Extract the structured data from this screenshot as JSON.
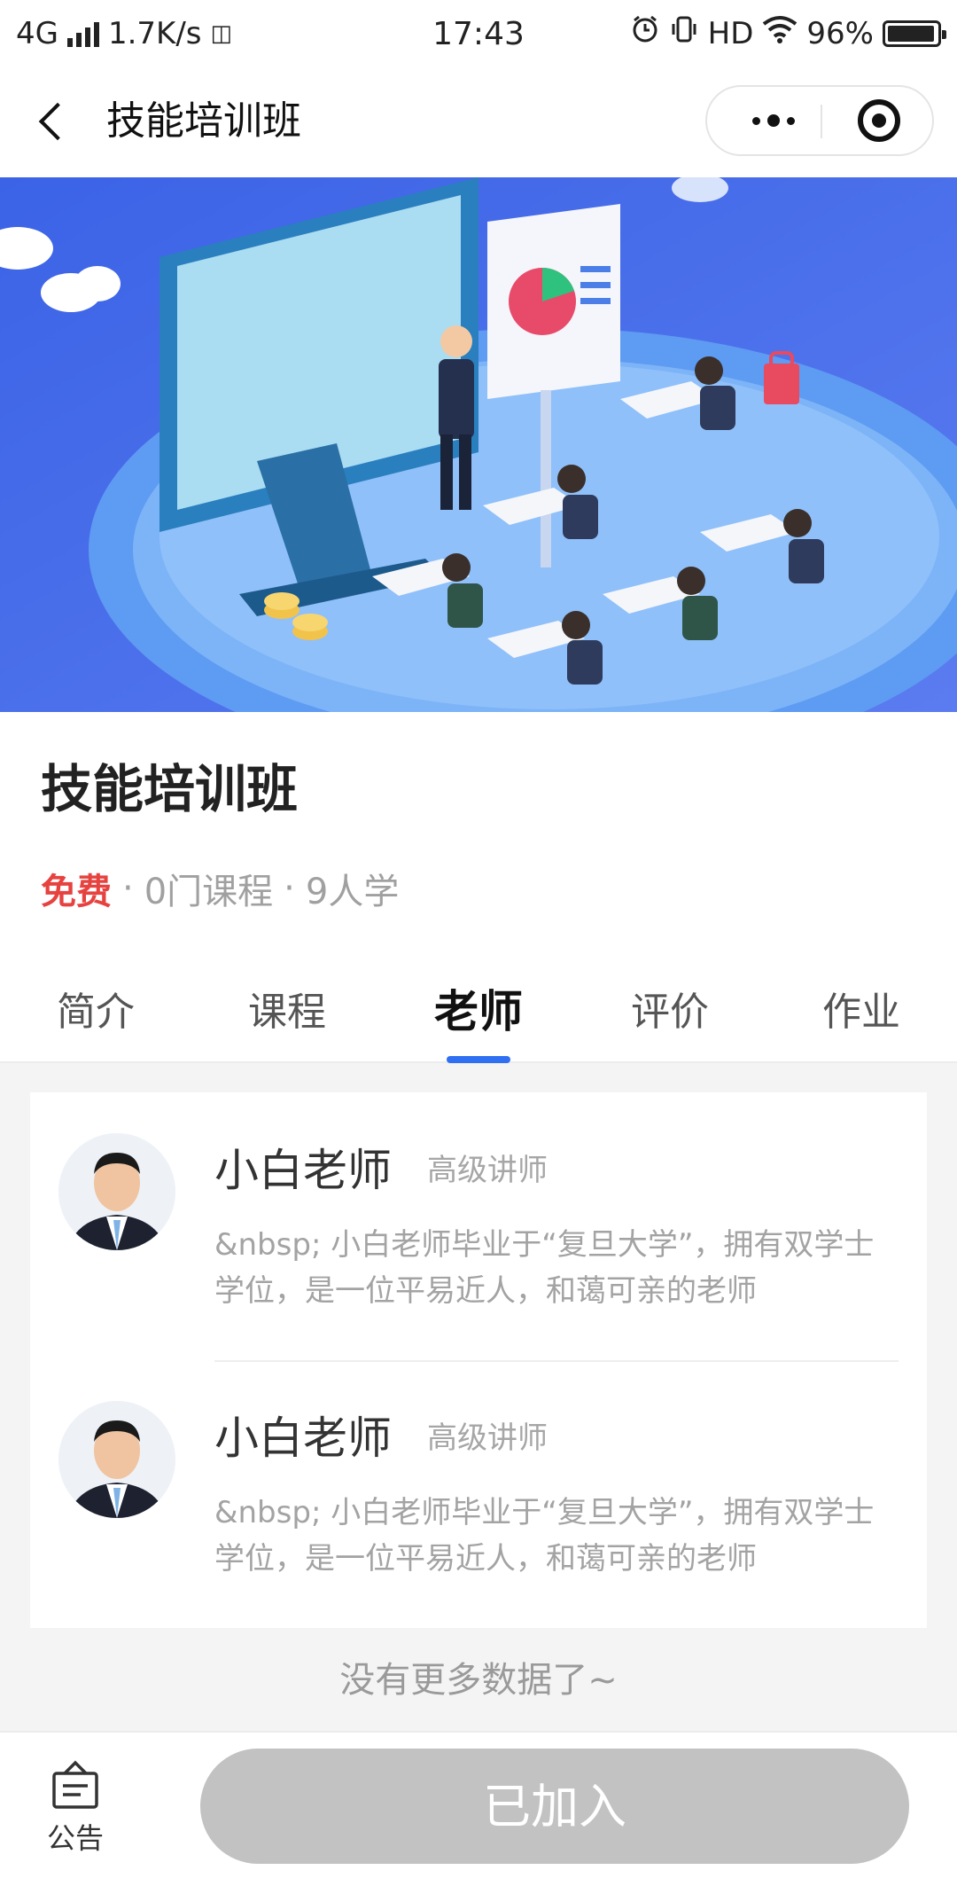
{
  "status_bar": {
    "network": "4G",
    "speed": "1.7K/s",
    "time": "17:43",
    "hd": "HD",
    "battery": "96%",
    "battery_level": 0.96
  },
  "nav": {
    "title": "技能培训班"
  },
  "course": {
    "title": "技能培训班",
    "price": "免费",
    "separator": "·",
    "courses": "0门课程",
    "learners": "9人学"
  },
  "tabs": [
    {
      "label": "简介",
      "active": false
    },
    {
      "label": "课程",
      "active": false
    },
    {
      "label": "老师",
      "active": true
    },
    {
      "label": "评价",
      "active": false
    },
    {
      "label": "作业",
      "active": false
    }
  ],
  "teachers": [
    {
      "name": "小白老师",
      "title": "高级讲师",
      "description": "&nbsp; 小白老师毕业于“复旦大学”，拥有双学士学位，是一位平易近人，和蔼可亲的老师"
    },
    {
      "name": "小白老师",
      "title": "高级讲师",
      "description": "&nbsp; 小白老师毕业于“复旦大学”，拥有双学士学位，是一位平易近人，和蔼可亲的老师"
    }
  ],
  "list_end": "没有更多数据了~",
  "bottom": {
    "notice_label": "公告",
    "join_label": "已加入"
  },
  "colors": {
    "price": "#e64340",
    "tab_indicator": "#2f6ff2",
    "join_button_disabled": "#c2c2c2"
  }
}
